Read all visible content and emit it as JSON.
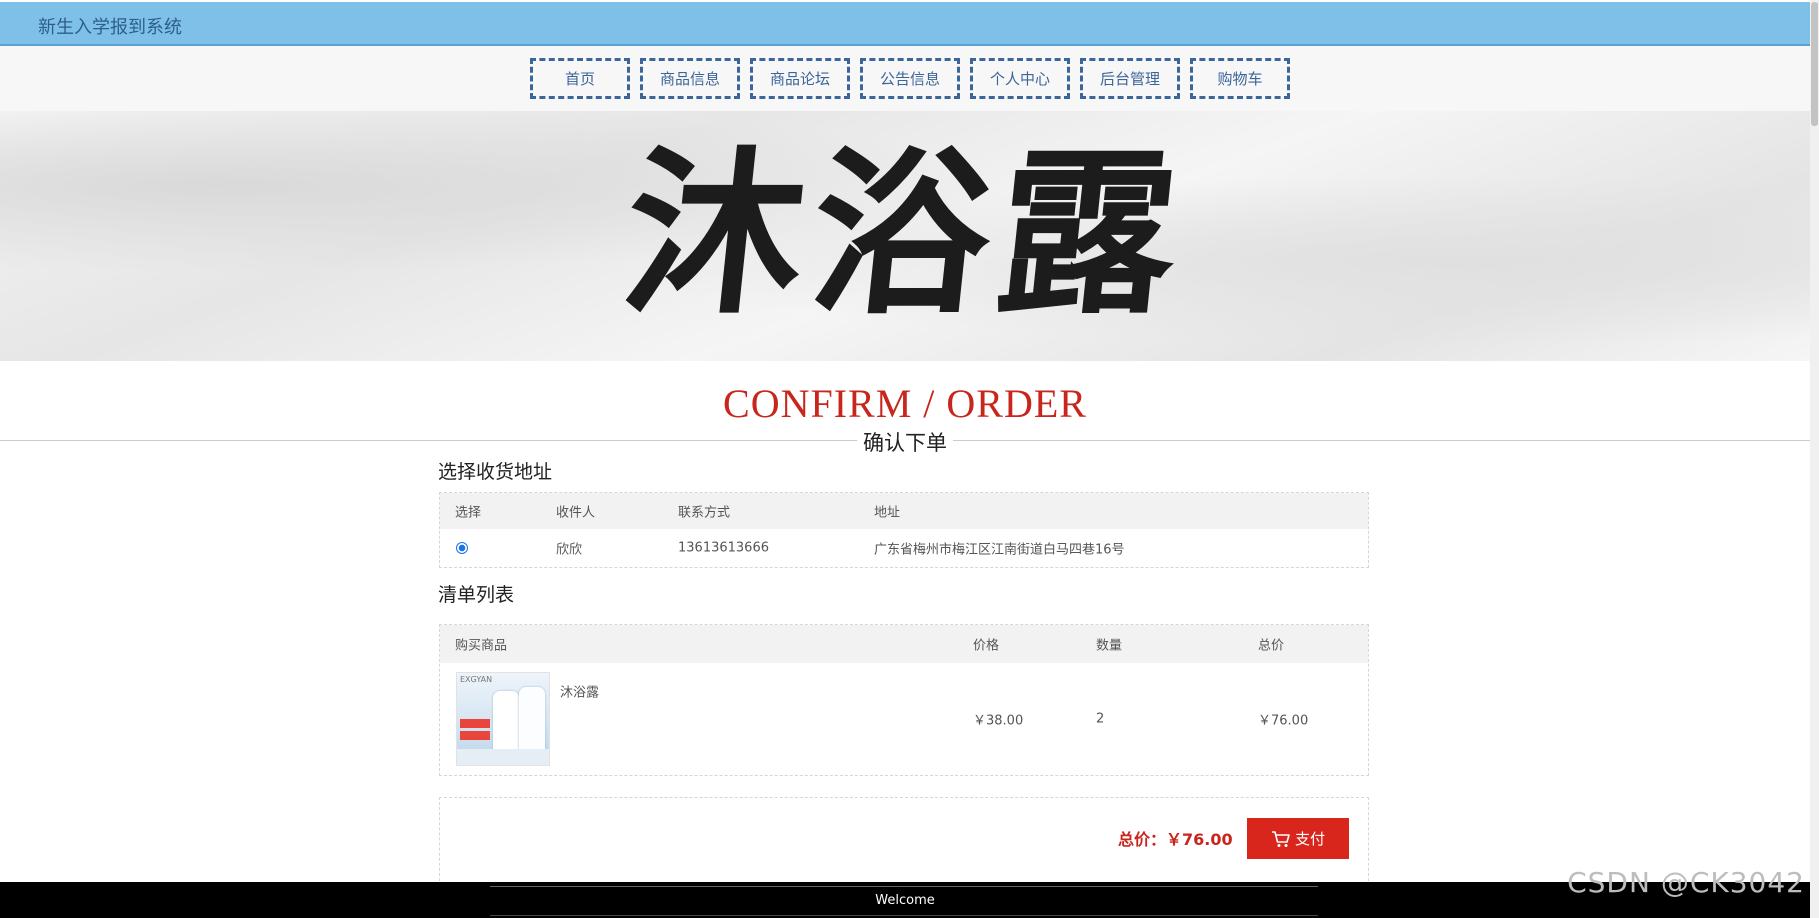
{
  "header": {
    "title": "新生入学报到系统"
  },
  "nav": {
    "items": [
      {
        "label": "首页"
      },
      {
        "label": "商品信息"
      },
      {
        "label": "商品论坛"
      },
      {
        "label": "公告信息"
      },
      {
        "label": "个人中心"
      },
      {
        "label": "后台管理"
      },
      {
        "label": "购物车"
      }
    ]
  },
  "banner": {
    "text": "沐浴露"
  },
  "page": {
    "title_en": "CONFIRM / ORDER",
    "title_cn": "确认下单"
  },
  "address": {
    "section_title": "选择收货地址",
    "columns": [
      "选择",
      "收件人",
      "联系方式",
      "地址"
    ],
    "rows": [
      {
        "selected": true,
        "recipient": "欣欣",
        "phone": "13613613666",
        "address": "广东省梅州市梅江区江南街道白马四巷16号"
      }
    ]
  },
  "order": {
    "section_title": "清单列表",
    "columns": [
      "购买商品",
      "价格",
      "数量",
      "总价"
    ],
    "rows": [
      {
        "product": "沐浴露",
        "price": "￥38.00",
        "qty": "2",
        "total": "￥76.00",
        "thumb_brand": "EXGYAN"
      }
    ]
  },
  "summary": {
    "total_label": "总价：￥76.00",
    "pay_label": "支付"
  },
  "footer": {
    "welcome": "Welcome"
  },
  "watermark": "CSDN @CK3042",
  "colors": {
    "accent_red": "#c8261c",
    "topbar_blue": "#7fc0e8",
    "nav_border": "#3c6599"
  },
  "icons": {
    "pay": "cart-icon"
  }
}
